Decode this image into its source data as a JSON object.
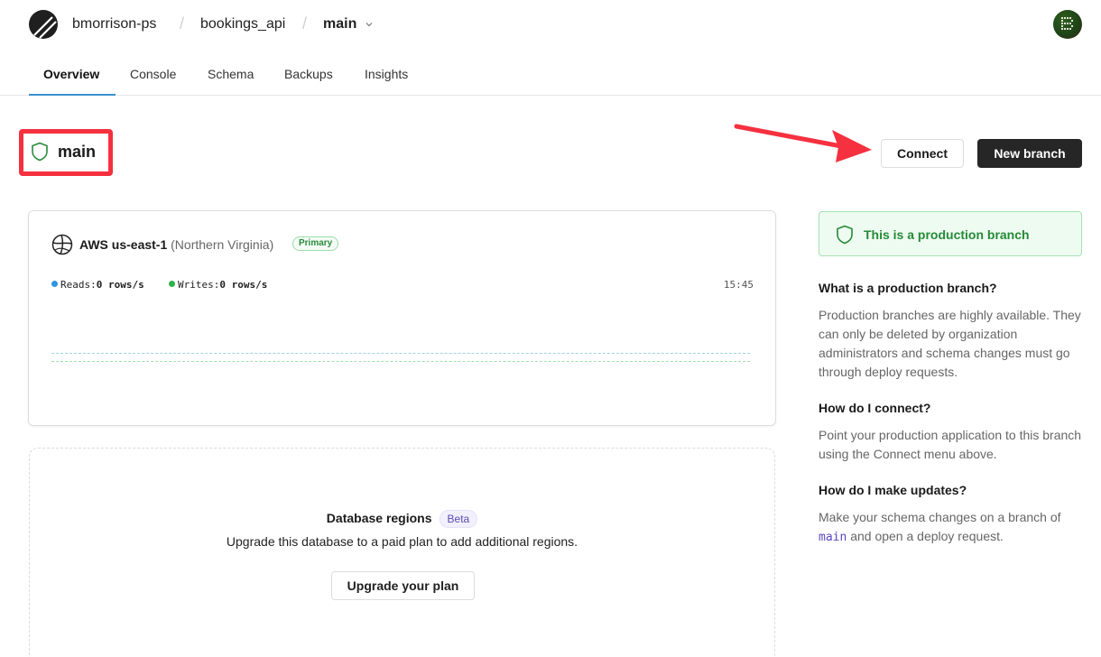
{
  "header": {
    "org": "bmorrison-ps",
    "database": "bookings_api",
    "branch": "main",
    "separator": "/",
    "logo_icon": "planetscale-logo-icon",
    "branch_dropdown_icon": "chevron-down-icon",
    "avatar_icon": "user-avatar-icon"
  },
  "tabs": [
    {
      "label": "Overview",
      "active": true
    },
    {
      "label": "Console",
      "active": false
    },
    {
      "label": "Schema",
      "active": false
    },
    {
      "label": "Backups",
      "active": false
    },
    {
      "label": "Insights",
      "active": false
    }
  ],
  "branch_header": {
    "title": "main",
    "icon": "shield-icon",
    "highlight_color": "#f5303f"
  },
  "actions": {
    "connect_label": "Connect",
    "new_branch_label": "New branch",
    "annotation_arrow_color": "#f5303f"
  },
  "region_card": {
    "provider_region": "AWS us-east-1",
    "location": "(Northern Virginia)",
    "badge": "Primary",
    "icon": "globe-icon",
    "reads_label": "Reads:",
    "reads_value": "0 rows/s",
    "writes_label": "Writes:",
    "writes_value": "0 rows/s",
    "time": "15:45",
    "reads_color": "#2f95dc",
    "writes_color": "#2fb34a"
  },
  "regions_box": {
    "title": "Database regions",
    "badge": "Beta",
    "description": "Upgrade this database to a paid plan to add additional regions.",
    "button_label": "Upgrade your plan"
  },
  "sidebar": {
    "banner": "This is a production branch",
    "banner_color": "#258a37",
    "faqs": [
      {
        "question": "What is a production branch?",
        "answer": "Production branches are highly available. They can only be deleted by organization administrators and schema changes must go through deploy requests."
      },
      {
        "question": "How do I connect?",
        "answer": "Point your production application to this branch using the Connect menu above."
      },
      {
        "question": "How do I make updates?",
        "answer_before": "Make your schema changes on a branch of ",
        "answer_code": "main",
        "answer_after": " and open a deploy request."
      }
    ]
  }
}
